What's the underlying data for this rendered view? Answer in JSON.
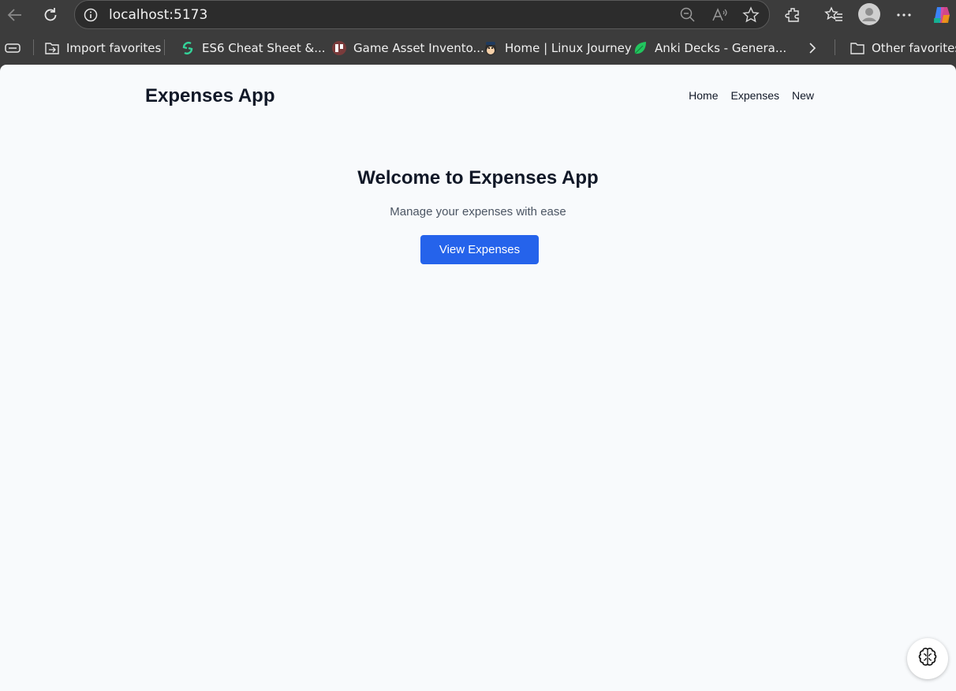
{
  "browser": {
    "url": "localhost:5173",
    "icons": [
      "back-icon",
      "refresh-icon",
      "info-icon",
      "zoom-out-icon",
      "read-aloud-icon",
      "favorite-star-icon",
      "extensions-icon",
      "favorites-icon",
      "profile-icon",
      "more-icon",
      "copilot-icon"
    ]
  },
  "bookmarks": {
    "items": [
      {
        "label": "Import favorites",
        "icon": "import-icon"
      },
      {
        "label": "ES6 Cheat Sheet &...",
        "icon": "es6-icon"
      },
      {
        "label": "Game Asset Invento...",
        "icon": "trello-icon"
      },
      {
        "label": "Home | Linux Journey",
        "icon": "linux-icon"
      },
      {
        "label": "Anki Decks - Genera...",
        "icon": "leaf-icon"
      }
    ],
    "other": "Other favorites"
  },
  "app": {
    "brand": "Expenses App",
    "nav": [
      "Home",
      "Expenses",
      "New"
    ],
    "hero": {
      "title": "Welcome to Expenses App",
      "subtitle": "Manage your expenses with ease",
      "cta": "View Expenses"
    },
    "accent": "#2563eb"
  }
}
